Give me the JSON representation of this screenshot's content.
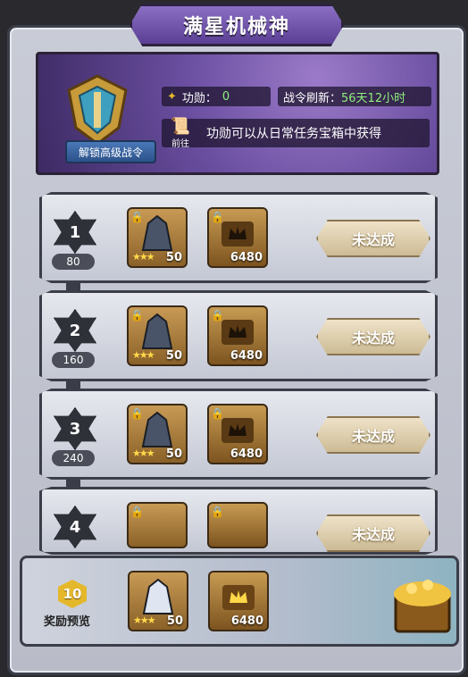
{
  "header": {
    "title": "满星机械神"
  },
  "banner": {
    "unlock_label": "解锁高级战令",
    "merit_label": "功勋：",
    "merit_value": "0",
    "refresh_label": "战令刷新：",
    "refresh_value": "56天12小时",
    "goto_label": "前往",
    "hint": "功勋可以从日常任务宝箱中获得"
  },
  "rows": [
    {
      "level": "1",
      "points": "80",
      "hero_count": "50",
      "chest_count": "6480",
      "status": "未达成"
    },
    {
      "level": "2",
      "points": "160",
      "hero_count": "50",
      "chest_count": "6480",
      "status": "未达成"
    },
    {
      "level": "3",
      "points": "240",
      "hero_count": "50",
      "chest_count": "6480",
      "status": "未达成"
    },
    {
      "level": "4",
      "points": "",
      "hero_count": "",
      "chest_count": "",
      "status": "未达成"
    }
  ],
  "footer": {
    "preview_level": "10",
    "preview_label": "奖励预览",
    "hero_count": "50",
    "chest_count": "6480"
  },
  "colors": {
    "banner_purple": "#6a4ea0",
    "accent_green": "#8ef07a",
    "gold": "#e5b82c"
  }
}
